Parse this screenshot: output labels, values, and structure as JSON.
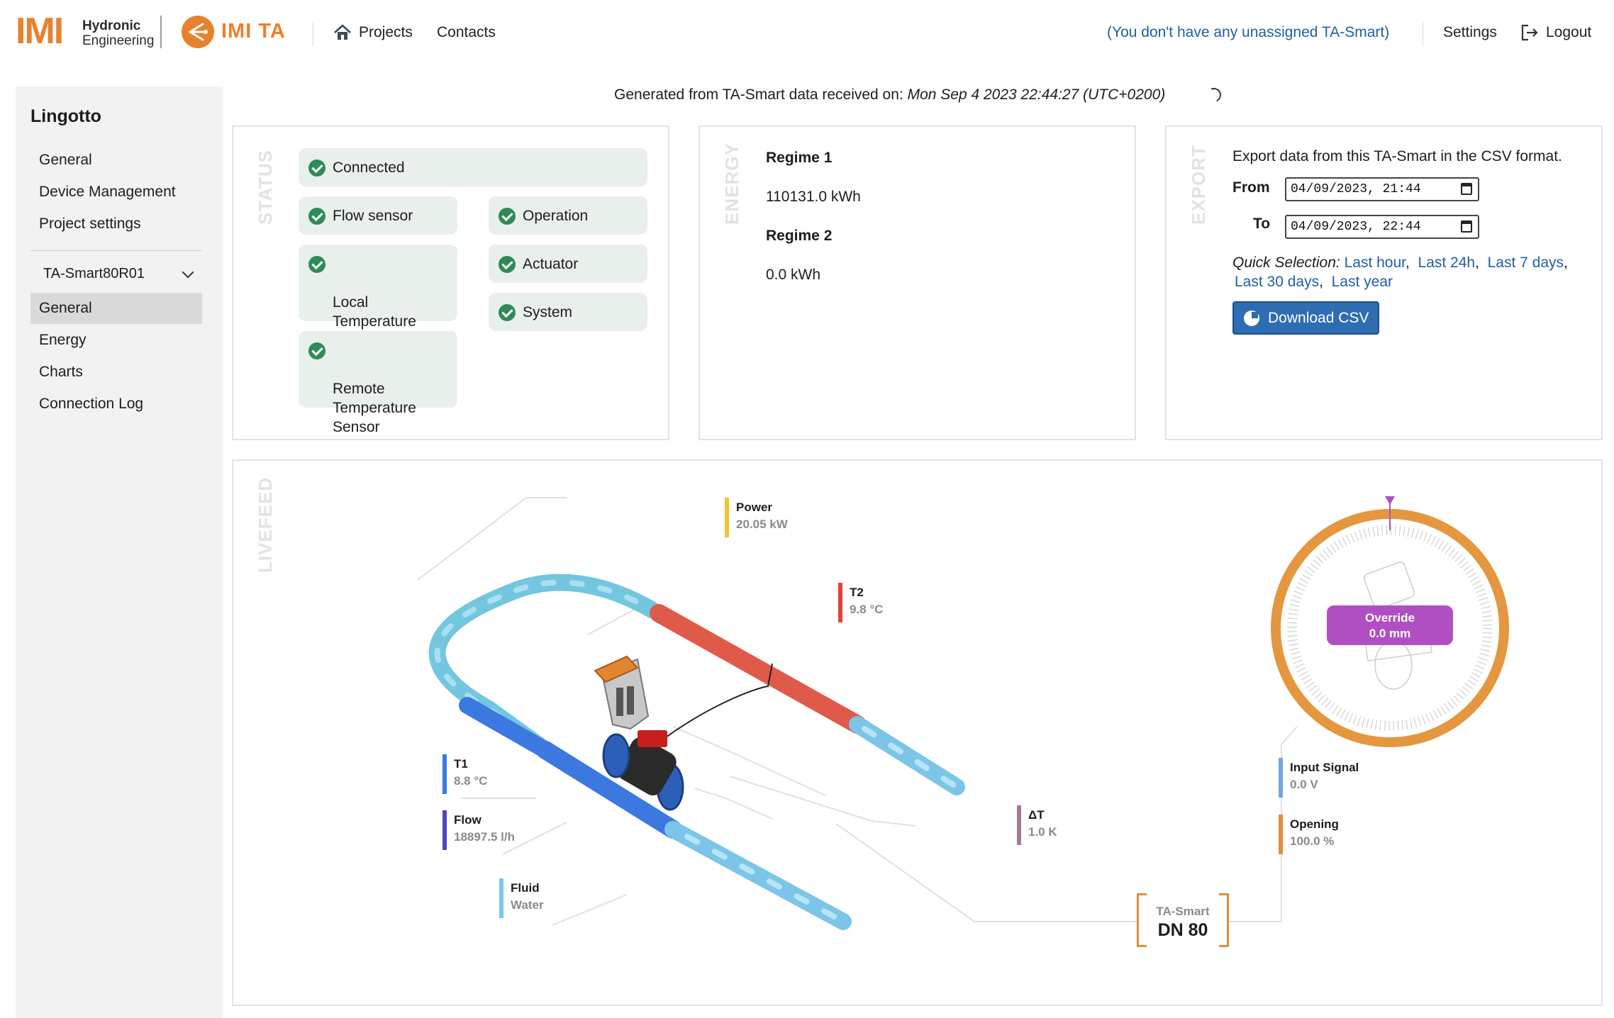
{
  "header": {
    "brand_mark": "IMI",
    "brand_line1": "Hydronic",
    "brand_line2": "Engineering",
    "ta_logo_text": "IMI TA",
    "nav": {
      "projects": "Projects",
      "contacts": "Contacts"
    },
    "unassigned_text": "(You don't have any unassigned TA-Smart)",
    "settings": "Settings",
    "logout": "Logout"
  },
  "sidebar": {
    "project_title": "Lingotto",
    "project_items": [
      {
        "label": "General"
      },
      {
        "label": "Device Management"
      },
      {
        "label": "Project settings"
      }
    ],
    "device_selected": "TA-Smart80R01",
    "device_items": [
      {
        "label": "General",
        "active": true
      },
      {
        "label": "Energy"
      },
      {
        "label": "Charts"
      },
      {
        "label": "Connection Log"
      }
    ]
  },
  "generated": {
    "prefix": "Generated from TA-Smart data received on:",
    "timestamp": "Mon Sep 4 2023 22:44:27 (UTC+0200)"
  },
  "status": {
    "section_label": "STATUS",
    "items": [
      {
        "label": "Connected",
        "state": "ok"
      },
      {
        "label": "Flow sensor",
        "state": "ok"
      },
      {
        "label": "Operation",
        "state": "ok"
      },
      {
        "label": "Local\nTemperature\nSensor",
        "state": "ok"
      },
      {
        "label": "Actuator",
        "state": "ok"
      },
      {
        "label": "System",
        "state": "ok"
      },
      {
        "label": "Remote\nTemperature\nSensor",
        "state": "ok"
      }
    ]
  },
  "energy": {
    "section_label": "ENERGY",
    "regime1_label": "Regime 1",
    "regime1_value": "110131.0 kWh",
    "regime2_label": "Regime 2",
    "regime2_value": "0.0 kWh"
  },
  "export": {
    "section_label": "EXPORT",
    "description": "Export data from this TA-Smart in the CSV format.",
    "from_label": "From",
    "from_value": "04/09/2023, 21:44",
    "to_label": "To",
    "to_value": "04/09/2023, 22:44",
    "quick_prefix": "Quick Selection:",
    "quick_links": [
      "Last hour",
      "Last 24h",
      "Last 7 days",
      "Last 30 days",
      "Last year"
    ],
    "download_label": "Download CSV"
  },
  "livefeed": {
    "section_label": "LIVEFEED",
    "power": {
      "name": "Power",
      "value": "20.05 kW"
    },
    "t2": {
      "name": "T2",
      "value": "9.8 °C"
    },
    "t1": {
      "name": "T1",
      "value": "8.8 °C"
    },
    "flow": {
      "name": "Flow",
      "value": "18897.5 l/h"
    },
    "fluid": {
      "name": "Fluid",
      "value": "Water"
    },
    "delta_t": {
      "name": "ΔT",
      "value": "1.0 K"
    },
    "input_signal": {
      "name": "Input Signal",
      "value": "0.0 V"
    },
    "opening": {
      "name": "Opening",
      "value": "100.0 %"
    },
    "device_type": "TA-Smart",
    "device_size": "DN 80",
    "override_label": "Override",
    "override_value": "0.0 mm"
  },
  "colors": {
    "accent_orange": "#e8812e",
    "link_blue": "#1f5fa6",
    "ok_green": "#2e8b57",
    "button_blue": "#2f6db3",
    "power_yellow": "#f2c12e",
    "t2_red": "#e0443a",
    "t1_blue": "#3b79e0",
    "flow_indigo": "#4a46c7",
    "fluid_lightblue": "#7cc4e8",
    "delta_mauve": "#a07a9a",
    "signal_blue": "#6fa8dc",
    "opening_orange": "#e28e3a",
    "override_purple": "#b04fc3"
  }
}
